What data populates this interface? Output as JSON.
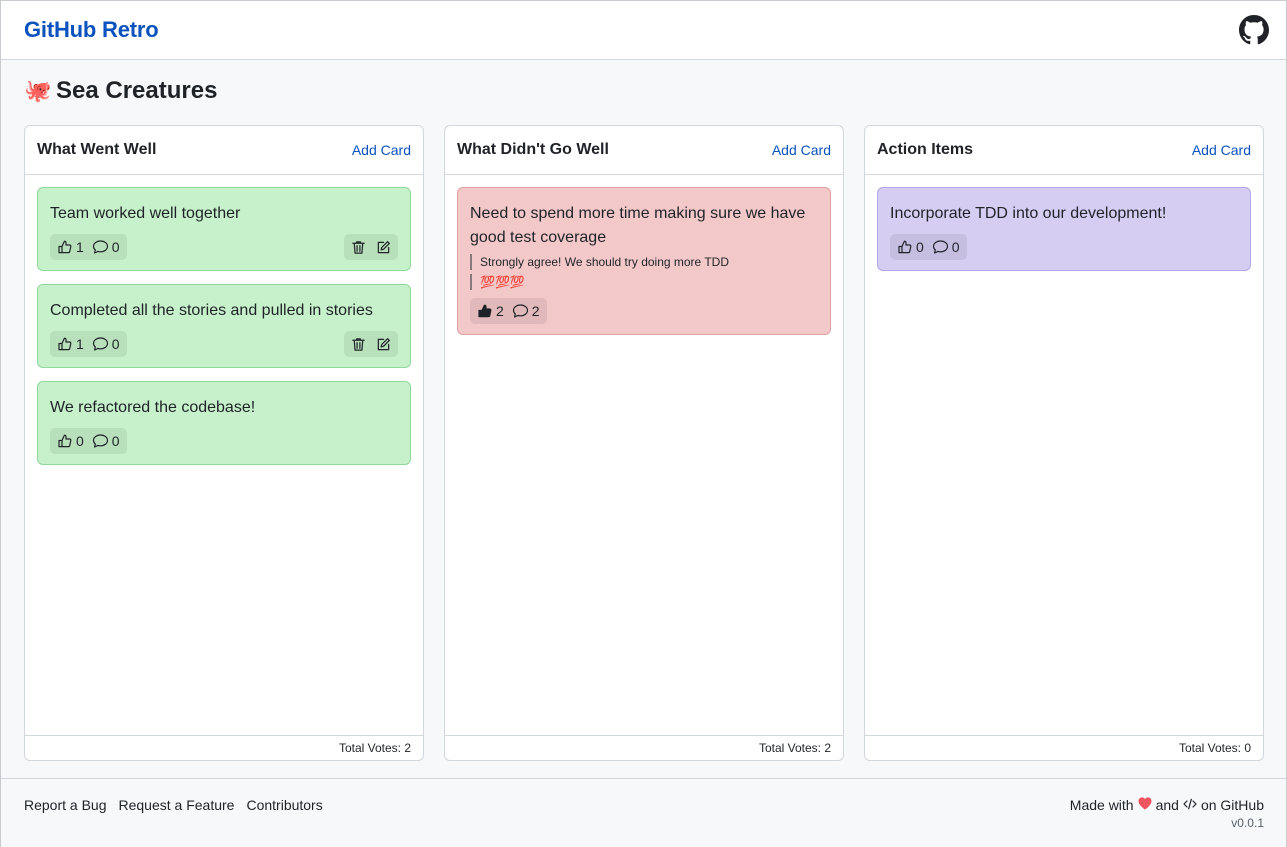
{
  "app": {
    "brand": "GitHub Retro",
    "board_title": "Sea Creatures",
    "board_emoji": "🐙"
  },
  "columns": [
    {
      "title": "What Went Well",
      "add_label": "Add Card",
      "total_votes_label": "Total Votes: 2",
      "color": "#c6f1ca",
      "cards": [
        {
          "text": "Team worked well together",
          "votes": "1",
          "comments_count": "0",
          "comments": []
        },
        {
          "text": "Completed all the stories and pulled in stories",
          "votes": "1",
          "comments_count": "0",
          "comments": []
        },
        {
          "text": "We refactored the codebase!",
          "votes": "0",
          "comments_count": "0",
          "comments": []
        }
      ]
    },
    {
      "title": "What Didn't Go Well",
      "add_label": "Add Card",
      "total_votes_label": "Total Votes: 2",
      "color": "#f3c8c9",
      "cards": [
        {
          "text": "Need to spend more time making sure we have good test coverage",
          "votes": "2",
          "comments_count": "2",
          "comments": [
            "Strongly agree! We should try doing more TDD",
            "💯💯💯"
          ]
        }
      ]
    },
    {
      "title": "Action Items",
      "add_label": "Add Card",
      "total_votes_label": "Total Votes: 0",
      "color": "#d6cdf3",
      "cards": [
        {
          "text": "Incorporate TDD into our development!",
          "votes": "0",
          "comments_count": "0",
          "comments": []
        }
      ]
    }
  ],
  "footer": {
    "links": [
      "Report a Bug",
      "Request a Feature",
      "Contributors"
    ],
    "made_with_prefix": "Made with",
    "made_with_and": "and",
    "made_with_suffix": "on GitHub",
    "version": "v0.0.1"
  },
  "icons": {
    "brand_link": "github-mark-icon",
    "vote": "thumbs-up-icon",
    "comment": "comment-icon",
    "delete": "trash-icon",
    "edit": "pencil-square-icon",
    "love": "heart-icon",
    "code": "code-icon"
  }
}
